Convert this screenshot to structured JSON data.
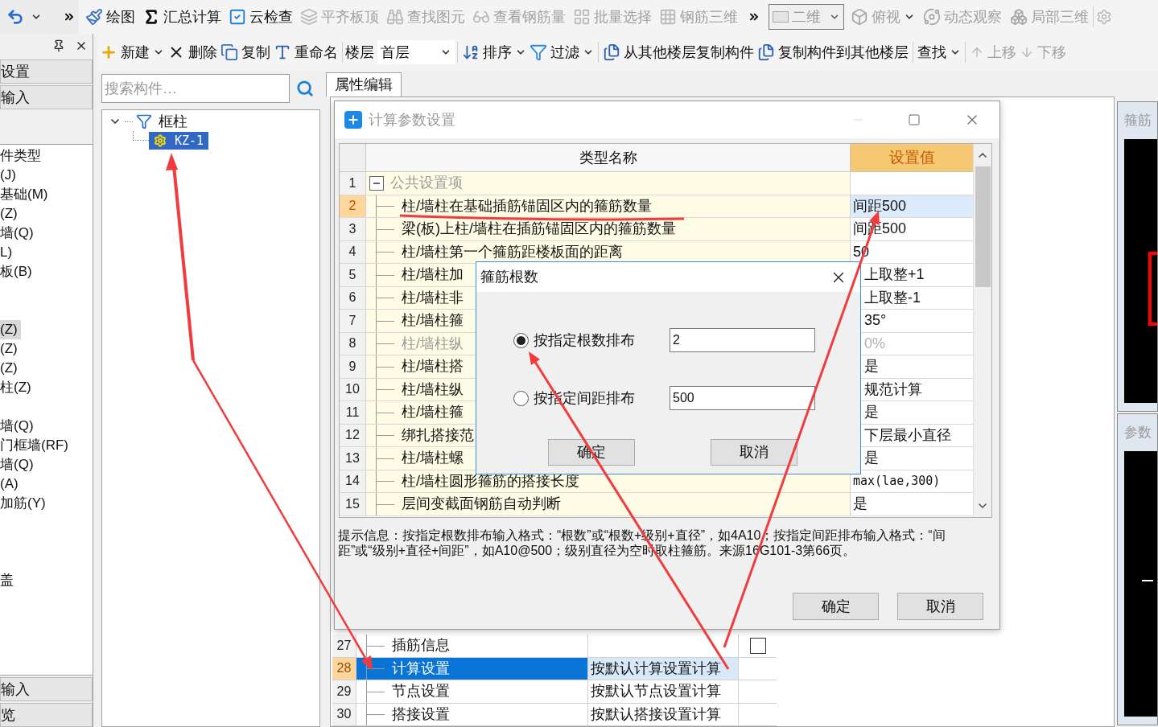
{
  "toolbar_1": {
    "undo": {
      "dropdown": true
    },
    "items": [
      {
        "label": "绘图",
        "disabled": false,
        "dropdown": false
      },
      {
        "label": "汇总计算",
        "disabled": false,
        "dropdown": false
      },
      {
        "label": "云检查",
        "disabled": false,
        "dropdown": false
      },
      {
        "label": "平齐板顶",
        "disabled": true,
        "dropdown": false
      },
      {
        "label": "查找图元",
        "disabled": true,
        "dropdown": false
      },
      {
        "label": "查看钢筋量",
        "disabled": true,
        "dropdown": false
      },
      {
        "label": "批量选择",
        "disabled": true,
        "dropdown": false
      },
      {
        "label": "钢筋三维",
        "disabled": true,
        "dropdown": false
      }
    ],
    "view_combo": {
      "value": "二维"
    },
    "view_items": [
      {
        "label": "俯视",
        "disabled": true,
        "dropdown": true
      },
      {
        "label": "动态观察",
        "disabled": true,
        "dropdown": false
      },
      {
        "label": "局部三维",
        "disabled": true,
        "dropdown": false
      }
    ]
  },
  "toolbar_2": {
    "items_a": [
      {
        "label": "新建",
        "disabled": false,
        "dropdown": true
      },
      {
        "label": "删除",
        "disabled": false,
        "dropdown": false
      },
      {
        "label": "复制",
        "disabled": false,
        "dropdown": false
      },
      {
        "label": "重命名",
        "disabled": false,
        "dropdown": false
      }
    ],
    "floor": {
      "label": "楼层",
      "value": "首层"
    },
    "items_b": [
      {
        "label": "排序",
        "disabled": false,
        "dropdown": true
      },
      {
        "label": "过滤",
        "disabled": false,
        "dropdown": true
      },
      {
        "label": "从其他楼层复制构件",
        "disabled": false,
        "dropdown": false
      },
      {
        "label": "复制构件到其他楼层",
        "disabled": false,
        "dropdown": false
      },
      {
        "label": "查找",
        "disabled": false,
        "dropdown": true
      },
      {
        "label": "上移",
        "disabled": true,
        "dropdown": false
      },
      {
        "label": "下移",
        "disabled": true,
        "dropdown": false
      }
    ]
  },
  "left_panel": {
    "sections_top": [
      {
        "label": "设置"
      },
      {
        "label": "输入"
      }
    ],
    "groups": [
      {
        "items": [
          {
            "label": "件类型",
            "selected": false
          },
          {
            "label": "(J)",
            "selected": false
          },
          {
            "label": "基础(M)",
            "selected": false
          },
          {
            "label": "(Z)",
            "selected": false
          },
          {
            "label": "墙(Q)",
            "selected": false
          },
          {
            "label": "L)",
            "selected": false
          },
          {
            "label": "板(B)",
            "selected": false
          }
        ]
      },
      {
        "items": [
          {
            "label": "(Z)",
            "selected": true
          },
          {
            "label": "(Z)",
            "selected": false
          },
          {
            "label": "(Z)",
            "selected": false
          },
          {
            "label": "柱(Z)",
            "selected": false
          }
        ]
      },
      {
        "items": [
          {
            "label": "墙(Q)",
            "selected": false
          },
          {
            "label": "门框墙(RF)",
            "selected": false
          },
          {
            "label": "墙(Q)",
            "selected": false
          },
          {
            "label": "(A)",
            "selected": false
          },
          {
            "label": "加筋(Y)",
            "selected": false
          }
        ]
      },
      {
        "items": [
          {
            "label": "盖",
            "selected": false
          }
        ]
      }
    ],
    "sections_bottom": [
      {
        "label": "输入"
      },
      {
        "label": "览"
      }
    ]
  },
  "tree": {
    "search": {
      "placeholder": "搜索构件…"
    },
    "nodes": [
      {
        "label": "框柱",
        "expanded": true,
        "selected": false,
        "children": [
          {
            "label": "KZ-1",
            "selected": true
          }
        ]
      }
    ]
  },
  "properties": {
    "tab": {
      "label": "属性编辑",
      "selected": true
    },
    "rows": [
      {
        "number": "27",
        "name": "插筋信息",
        "selected": false,
        "checkbox": {
          "checked": false
        }
      },
      {
        "number": "28",
        "name": "计算设置",
        "value": "按默认计算设置计算",
        "selected": true
      },
      {
        "number": "29",
        "name": "节点设置",
        "value": "按默认节点设置计算",
        "selected": false
      },
      {
        "number": "30",
        "name": "搭接设置",
        "value": "按默认搭接设置计算",
        "selected": false
      }
    ]
  },
  "right_panel": {
    "panels": [
      {
        "title": "箍筋"
      },
      {
        "title": "参数"
      }
    ]
  },
  "calc_dialog": {
    "title": "计算参数设置",
    "columns": [
      "类型名称",
      "设置值"
    ],
    "rows": [
      {
        "kind": "group",
        "number": "1",
        "name": "公共设置项",
        "expanded": true,
        "selected": false,
        "disabled": true
      },
      {
        "kind": "item",
        "number": "2",
        "name": "柱/墙柱在基础插筋锚固区内的箍筋数量",
        "value": "间距500",
        "selected": true,
        "disabled": false
      },
      {
        "kind": "item",
        "number": "3",
        "name": "梁(板)上柱/墙柱在插筋锚固区内的箍筋数量",
        "value": "间距500",
        "selected": false,
        "disabled": false
      },
      {
        "kind": "item",
        "number": "4",
        "name": "柱/墙柱第一个箍筋距楼板面的距离",
        "value": "50",
        "selected": false,
        "disabled": false
      },
      {
        "kind": "item",
        "number": "5",
        "name": "柱/墙柱加",
        "value": "上取整+1",
        "selected": false,
        "disabled": false
      },
      {
        "kind": "item",
        "number": "6",
        "name": "柱/墙柱非",
        "value": "上取整-1",
        "selected": false,
        "disabled": false
      },
      {
        "kind": "item",
        "number": "7",
        "name": "柱/墙柱箍",
        "value": "35°",
        "selected": false,
        "disabled": false
      },
      {
        "kind": "item",
        "number": "8",
        "name": "柱/墙柱纵",
        "value": "0%",
        "selected": false,
        "disabled": true
      },
      {
        "kind": "item",
        "number": "9",
        "name": "柱/墙柱搭",
        "value": "是",
        "selected": false,
        "disabled": false
      },
      {
        "kind": "item",
        "number": "10",
        "name": "柱/墙柱纵",
        "value": "规范计算",
        "selected": false,
        "disabled": false
      },
      {
        "kind": "item",
        "number": "11",
        "name": "柱/墙柱箍",
        "value": "是",
        "selected": false,
        "disabled": false
      },
      {
        "kind": "item",
        "number": "12",
        "name": "绑扎搭接范",
        "value": "下层最小直径",
        "selected": false,
        "disabled": false
      },
      {
        "kind": "item",
        "number": "13",
        "name": "柱/墙柱螺",
        "value": "是",
        "selected": false,
        "disabled": false
      },
      {
        "kind": "item",
        "number": "14",
        "name": "柱/墙柱圆形箍筋的搭接长度",
        "value": "max(lae,300)",
        "selected": false,
        "disabled": false
      },
      {
        "kind": "item",
        "number": "15",
        "name": "层间变截面钢筋自动判断",
        "value": "是",
        "selected": false,
        "disabled": false
      }
    ],
    "hint": "提示信息：按指定根数排布输入格式：“根数”或“根数+级别+直径”，如4A10；按指定间距排布输入格式：“间距”或“级别+直径+间距”，如A10@500；级别直径为空时取柱箍筋。来源16G101-3第66页。",
    "buttons": [
      "确定",
      "取消"
    ]
  },
  "stirrup_dialog": {
    "title": "箍筋根数",
    "options": [
      {
        "label": "按指定根数排布",
        "selected": true,
        "value": "2"
      },
      {
        "label": "按指定间距排布",
        "selected": false,
        "value": "500"
      }
    ],
    "buttons": [
      "确定",
      "取消"
    ]
  }
}
